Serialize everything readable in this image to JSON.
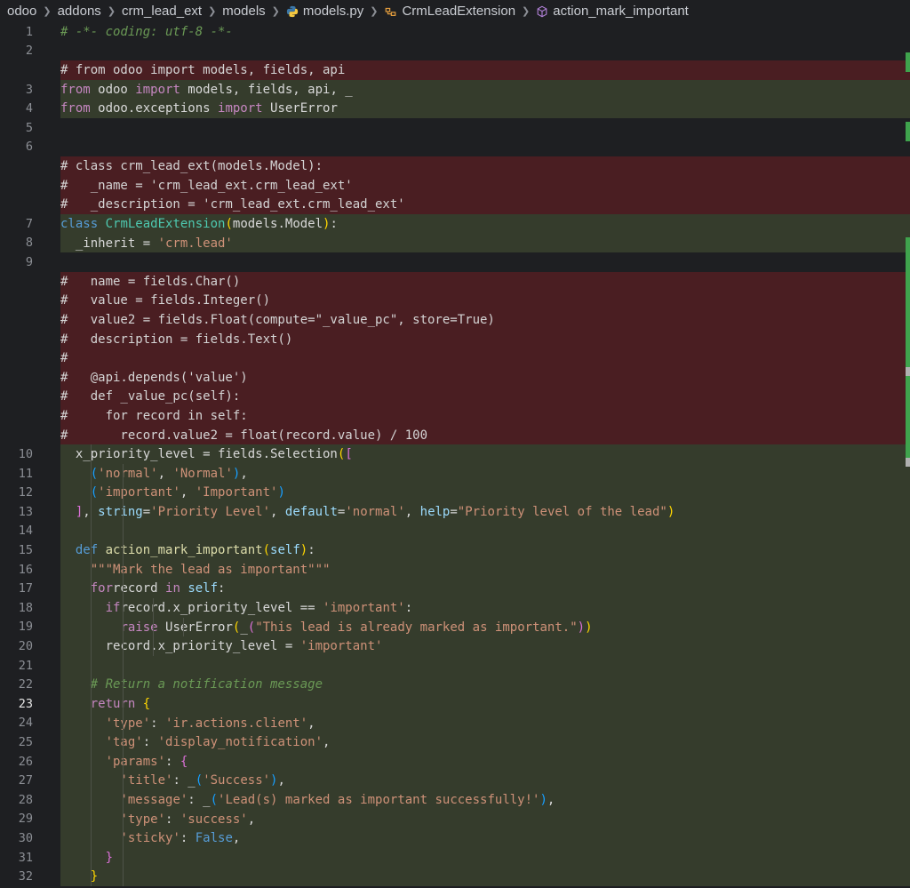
{
  "breadcrumb": {
    "items": [
      "odoo",
      "addons",
      "crm_lead_ext",
      "models",
      "models.py",
      "CrmLeadExtension",
      "action_mark_important"
    ]
  },
  "editor": {
    "active_line": "23",
    "rows": [
      {
        "n": "1",
        "kind": "none",
        "t": [
          [
            "cmt",
            "# -*- coding: utf-8 -*-"
          ]
        ]
      },
      {
        "n": "2",
        "kind": "none",
        "t": []
      },
      {
        "n": "",
        "kind": "del",
        "t": [
          [
            "cmtp",
            "# from odoo import models, fields, api"
          ]
        ]
      },
      {
        "n": "3",
        "kind": "add",
        "t": [
          [
            "kw",
            "from"
          ],
          [
            "",
            "  odoo "
          ],
          [
            "kw",
            "import"
          ],
          [
            "",
            "  models, fields, api, _"
          ]
        ]
      },
      {
        "n": "4",
        "kind": "add",
        "t": [
          [
            "kw",
            "from"
          ],
          [
            "",
            "  odoo.exceptions "
          ],
          [
            "kw",
            "import"
          ],
          [
            "",
            "  UserError"
          ]
        ]
      },
      {
        "n": "5",
        "kind": "none",
        "t": []
      },
      {
        "n": "6",
        "kind": "none",
        "t": []
      },
      {
        "n": "",
        "kind": "del",
        "t": [
          [
            "cmtp",
            "# class crm_lead_ext(models.Model):"
          ]
        ]
      },
      {
        "n": "",
        "kind": "del",
        "t": [
          [
            "cmtp",
            "#     _name = 'crm_lead_ext.crm_lead_ext'"
          ]
        ]
      },
      {
        "n": "",
        "kind": "del",
        "t": [
          [
            "cmtp",
            "#     _description = 'crm_lead_ext.crm_lead_ext'"
          ]
        ]
      },
      {
        "n": "7",
        "kind": "add",
        "t": [
          [
            "kwb",
            "class"
          ],
          [
            "",
            " "
          ],
          [
            "cls",
            "CrmLeadExtension"
          ],
          [
            "br1",
            "("
          ],
          [
            "",
            "models.Model"
          ],
          [
            "br1",
            ")"
          ],
          [
            "",
            ":"
          ]
        ]
      },
      {
        "n": "8",
        "kind": "add",
        "t": [
          [
            "",
            "    _inherit = "
          ],
          [
            "str",
            "'crm.lead'"
          ]
        ]
      },
      {
        "n": "9",
        "kind": "none",
        "t": []
      },
      {
        "n": "",
        "kind": "del",
        "t": [
          [
            "cmtp",
            "#     name = fields.Char()"
          ]
        ]
      },
      {
        "n": "",
        "kind": "del",
        "t": [
          [
            "cmtp",
            "#     value = fields.Integer()"
          ]
        ]
      },
      {
        "n": "",
        "kind": "del",
        "t": [
          [
            "cmtp",
            "#     value2 = fields.Float(compute=\"_value_pc\", store=True)"
          ]
        ]
      },
      {
        "n": "",
        "kind": "del",
        "t": [
          [
            "cmtp",
            "#     description = fields.Text()"
          ]
        ]
      },
      {
        "n": "",
        "kind": "del",
        "t": [
          [
            "cmtp",
            "#"
          ]
        ]
      },
      {
        "n": "",
        "kind": "del",
        "t": [
          [
            "cmtp",
            "#     @api.depends('value')"
          ]
        ]
      },
      {
        "n": "",
        "kind": "del",
        "t": [
          [
            "cmtp",
            "#     def _value_pc(self):"
          ]
        ]
      },
      {
        "n": "",
        "kind": "del",
        "t": [
          [
            "cmtp",
            "#         for record in self:"
          ]
        ]
      },
      {
        "n": "",
        "kind": "del",
        "t": [
          [
            "cmtp",
            "#             record.value2 = float(record.value) / 100"
          ]
        ]
      },
      {
        "n": "10",
        "kind": "add",
        "t": [
          [
            "",
            "    x_priority_level = fields.Selection"
          ],
          [
            "br1",
            "("
          ],
          [
            "br2",
            "["
          ]
        ]
      },
      {
        "n": "11",
        "kind": "add",
        "t": [
          [
            "",
            "        "
          ],
          [
            "br3",
            "("
          ],
          [
            "str",
            "'normal'"
          ],
          [
            "",
            ", "
          ],
          [
            "str",
            "'Normal'"
          ],
          [
            "br3",
            ")"
          ],
          [
            "",
            ","
          ]
        ]
      },
      {
        "n": "12",
        "kind": "add",
        "t": [
          [
            "",
            "        "
          ],
          [
            "br3",
            "("
          ],
          [
            "str",
            "'important'"
          ],
          [
            "",
            ", "
          ],
          [
            "str",
            "'Important'"
          ],
          [
            "br3",
            ")"
          ]
        ]
      },
      {
        "n": "13",
        "kind": "add",
        "t": [
          [
            "",
            "    "
          ],
          [
            "br2",
            "]"
          ],
          [
            "",
            ", "
          ],
          [
            "param",
            "string"
          ],
          [
            "",
            "="
          ],
          [
            "str",
            "'Priority Level'"
          ],
          [
            "",
            ", "
          ],
          [
            "param",
            "default"
          ],
          [
            "",
            "="
          ],
          [
            "str",
            "'normal'"
          ],
          [
            "",
            ", "
          ],
          [
            "param",
            "help"
          ],
          [
            "",
            "="
          ],
          [
            "str",
            "\"Priority level of the lead\""
          ],
          [
            "br1",
            ")"
          ]
        ]
      },
      {
        "n": "14",
        "kind": "add",
        "t": []
      },
      {
        "n": "15",
        "kind": "add",
        "t": [
          [
            "",
            "    "
          ],
          [
            "kwb",
            "def"
          ],
          [
            "",
            " "
          ],
          [
            "fn",
            "action_mark_important"
          ],
          [
            "br1",
            "("
          ],
          [
            "self",
            "self"
          ],
          [
            "br1",
            ")"
          ],
          [
            "",
            ":"
          ]
        ]
      },
      {
        "n": "16",
        "kind": "add",
        "t": [
          [
            "",
            "        "
          ],
          [
            "str",
            "\"\"\"Mark the lead as important\"\"\""
          ]
        ]
      },
      {
        "n": "17",
        "kind": "add",
        "t": [
          [
            "",
            "        "
          ],
          [
            "kw",
            "for"
          ],
          [
            "",
            "",
            " "
          ],
          [
            "",
            "record "
          ],
          [
            "kw",
            "in"
          ],
          [
            "",
            " "
          ],
          [
            "self",
            "self"
          ],
          [
            "",
            ":"
          ]
        ]
      },
      {
        "n": "18",
        "kind": "add",
        "t": [
          [
            "",
            "            "
          ],
          [
            "kw",
            "if"
          ],
          [
            "",
            "",
            " "
          ],
          [
            "",
            "record.x_priority_level == "
          ],
          [
            "str",
            "'important'"
          ],
          [
            "",
            ":"
          ]
        ]
      },
      {
        "n": "19",
        "kind": "add",
        "t": [
          [
            "",
            "                "
          ],
          [
            "kw",
            "raise"
          ],
          [
            "",
            " UserError"
          ],
          [
            "br1",
            "("
          ],
          [
            "",
            "_"
          ],
          [
            "br2",
            "("
          ],
          [
            "str",
            "\"This lead is already marked as important.\""
          ],
          [
            "br2",
            ")"
          ],
          [
            "br1",
            ")"
          ]
        ]
      },
      {
        "n": "20",
        "kind": "add",
        "t": [
          [
            "",
            "            record.x_priority_level = "
          ],
          [
            "str",
            "'important'"
          ]
        ]
      },
      {
        "n": "21",
        "kind": "add",
        "t": []
      },
      {
        "n": "22",
        "kind": "add",
        "t": [
          [
            "",
            "        "
          ],
          [
            "cmt",
            "# Return a notification message"
          ]
        ]
      },
      {
        "n": "23",
        "kind": "add",
        "t": [
          [
            "",
            "        "
          ],
          [
            "kw",
            "return"
          ],
          [
            "",
            " "
          ],
          [
            "br1",
            "{"
          ]
        ]
      },
      {
        "n": "24",
        "kind": "add",
        "t": [
          [
            "",
            "            "
          ],
          [
            "str",
            "'type'"
          ],
          [
            "",
            ": "
          ],
          [
            "str",
            "'ir.actions.client'"
          ],
          [
            "",
            ","
          ]
        ]
      },
      {
        "n": "25",
        "kind": "add",
        "t": [
          [
            "",
            "            "
          ],
          [
            "str",
            "'tag'"
          ],
          [
            "",
            ": "
          ],
          [
            "str",
            "'display_notification'"
          ],
          [
            "",
            ","
          ]
        ]
      },
      {
        "n": "26",
        "kind": "add",
        "t": [
          [
            "",
            "            "
          ],
          [
            "str",
            "'params'"
          ],
          [
            "",
            ": "
          ],
          [
            "br2",
            "{"
          ]
        ]
      },
      {
        "n": "27",
        "kind": "add",
        "t": [
          [
            "",
            "                "
          ],
          [
            "str",
            "'title'"
          ],
          [
            "",
            ": _"
          ],
          [
            "br3",
            "("
          ],
          [
            "str",
            "'Success'"
          ],
          [
            "br3",
            ")"
          ],
          [
            "",
            ","
          ]
        ]
      },
      {
        "n": "28",
        "kind": "add",
        "t": [
          [
            "",
            "                "
          ],
          [
            "str",
            "'message'"
          ],
          [
            "",
            ": _"
          ],
          [
            "br3",
            "("
          ],
          [
            "str",
            "'Lead(s) marked as important successfully!'"
          ],
          [
            "br3",
            ")"
          ],
          [
            "",
            ","
          ]
        ]
      },
      {
        "n": "29",
        "kind": "add",
        "t": [
          [
            "",
            "                "
          ],
          [
            "str",
            "'type'"
          ],
          [
            "",
            ": "
          ],
          [
            "str",
            "'success'"
          ],
          [
            "",
            ","
          ]
        ]
      },
      {
        "n": "30",
        "kind": "add",
        "t": [
          [
            "",
            "                "
          ],
          [
            "str",
            "'sticky'"
          ],
          [
            "",
            ": "
          ],
          [
            "kwb",
            "False"
          ],
          [
            "",
            ","
          ]
        ]
      },
      {
        "n": "31",
        "kind": "add",
        "t": [
          [
            "",
            "            "
          ],
          [
            "br2",
            "}"
          ]
        ]
      },
      {
        "n": "32",
        "kind": "add",
        "t": [
          [
            "",
            "        "
          ],
          [
            "br1",
            "}"
          ]
        ]
      }
    ]
  },
  "colors": {
    "deleted_line_bg": "#4a1e22",
    "added_line_bg": "#353c2c",
    "editor_bg": "#1e1f22"
  }
}
